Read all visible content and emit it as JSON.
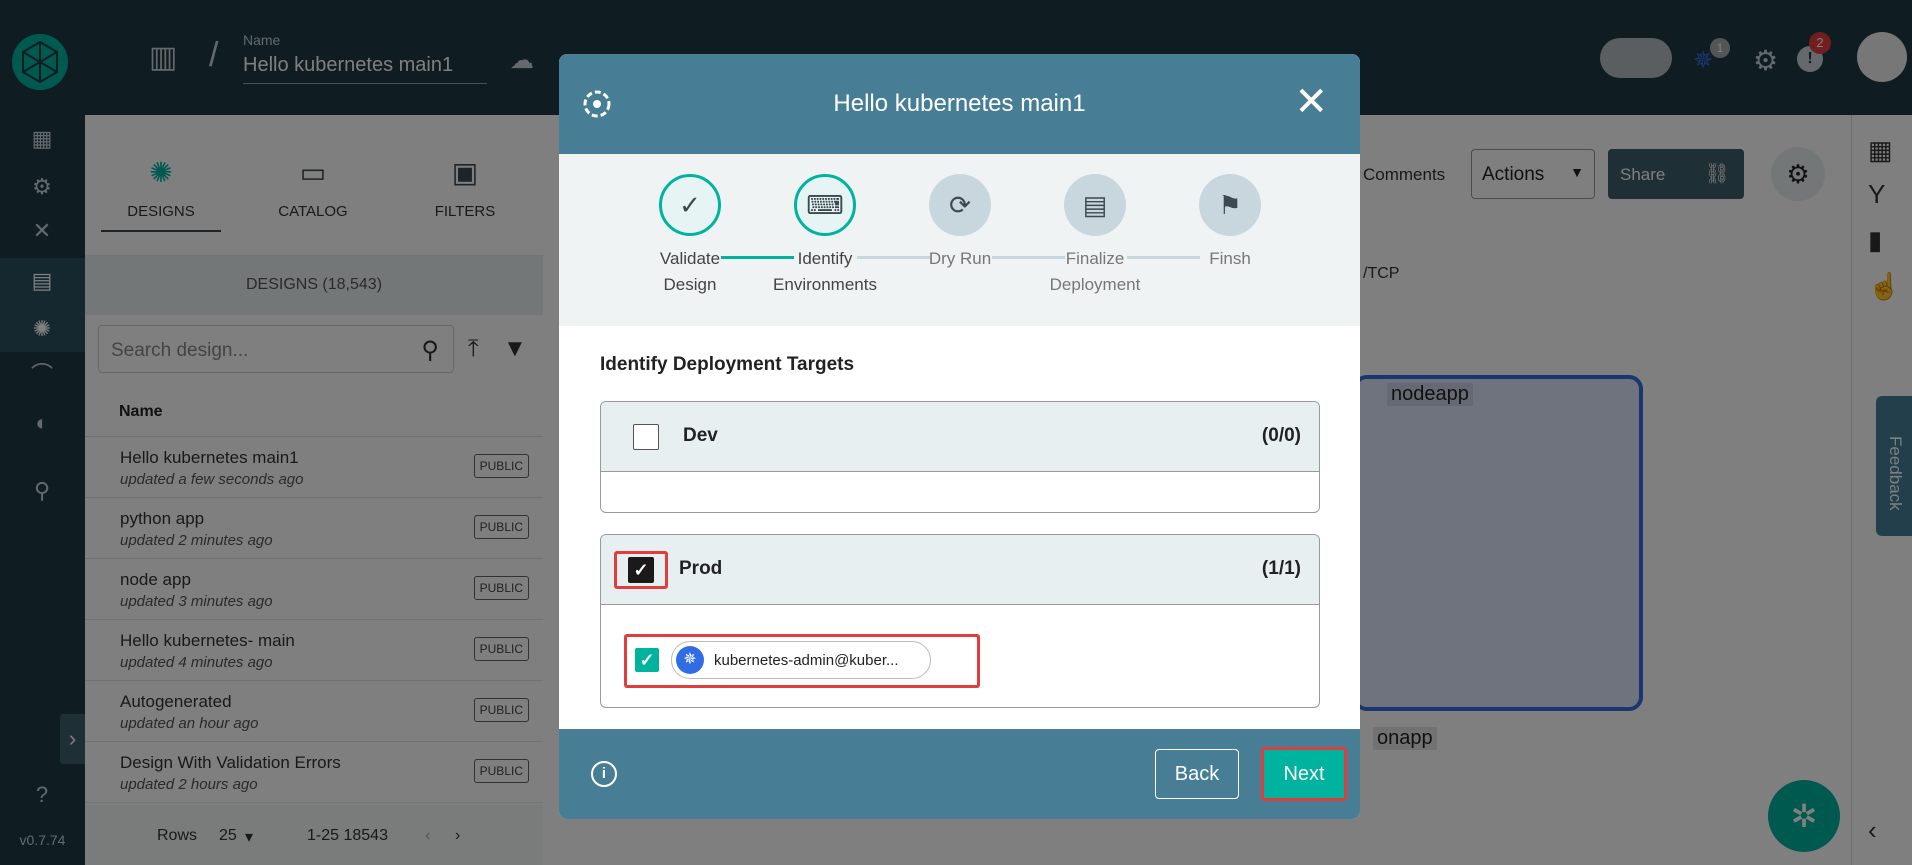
{
  "app": {
    "version": "v0.7.74"
  },
  "header": {
    "name_label": "Name",
    "design_name": "Hello kubernetes main1",
    "notifications_count": "2",
    "k8s_count": "1"
  },
  "designs_panel": {
    "tabs": [
      {
        "label": "DESIGNS",
        "icon": "designs-icon"
      },
      {
        "label": "CATALOG",
        "icon": "catalog-icon"
      },
      {
        "label": "FILTERS",
        "icon": "filters-icon"
      }
    ],
    "count_label": "DESIGNS (18,543)",
    "search_placeholder": "Search design...",
    "column_name": "Name",
    "rows": [
      {
        "name": "Hello kubernetes main1",
        "sub": "updated a few seconds ago",
        "badge": "PUBLIC"
      },
      {
        "name": "python app",
        "sub": "updated 2 minutes ago",
        "badge": "PUBLIC"
      },
      {
        "name": "node app",
        "sub": "updated 3 minutes ago",
        "badge": "PUBLIC"
      },
      {
        "name": "Hello kubernetes- main",
        "sub": "updated 4 minutes ago",
        "badge": "PUBLIC"
      },
      {
        "name": "Autogenerated",
        "sub": "updated an hour ago",
        "badge": "PUBLIC"
      },
      {
        "name": "Design With Validation Errors",
        "sub": "updated 2 hours ago",
        "badge": "PUBLIC"
      }
    ],
    "footer": {
      "rows_label": "Rows",
      "rows_value": "25",
      "range": "1-25 18543"
    }
  },
  "canvas": {
    "comments_label": "Comments",
    "actions_label": "Actions",
    "share_label": "Share",
    "tcp_label": "/TCP",
    "node_label": "nodeapp",
    "python_label": "onapp",
    "feedback_label": "Feedback"
  },
  "modal": {
    "title": "Hello kubernetes main1",
    "steps": [
      {
        "label_line1": "Validate",
        "label_line2": "Design",
        "state": "done",
        "icon": "check-icon"
      },
      {
        "label_line1": "Identify",
        "label_line2": "Environments",
        "state": "current",
        "icon": "environment-icon"
      },
      {
        "label_line1": "Dry Run",
        "label_line2": "",
        "state": "future",
        "icon": "dry-run-icon"
      },
      {
        "label_line1": "Finalize",
        "label_line2": "Deployment",
        "state": "future",
        "icon": "clipboard-icon"
      },
      {
        "label_line1": "Finsh",
        "label_line2": "",
        "state": "future",
        "icon": "flags-icon"
      }
    ],
    "section_title": "Identify Deployment Targets",
    "environments": [
      {
        "name": "Dev",
        "count": "(0/0)",
        "checked": false,
        "connections": []
      },
      {
        "name": "Prod",
        "count": "(1/1)",
        "checked": true,
        "connections": [
          {
            "label": "kubernetes-admin@kuber...",
            "checked": true
          }
        ]
      }
    ],
    "back_label": "Back",
    "next_label": "Next",
    "info_label": "i"
  },
  "colors": {
    "accent": "#00b39f",
    "header_bg": "#1e3b47",
    "modal_header": "#477e96",
    "highlight": "#e23d3d"
  }
}
